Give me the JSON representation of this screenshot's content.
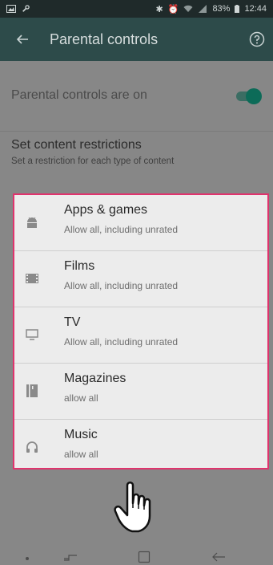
{
  "status_bar": {
    "battery": "83%",
    "time": "12:44"
  },
  "app_bar": {
    "title": "Parental controls"
  },
  "settings": {
    "toggle_label": "Parental controls are on",
    "restrictions_title": "Set content restrictions",
    "restrictions_subtitle": "Set a restriction for each type of content"
  },
  "categories": [
    {
      "icon": "android-icon",
      "title": "Apps & games",
      "subtitle": "Allow all, including unrated"
    },
    {
      "icon": "film-icon",
      "title": "Films",
      "subtitle": "Allow all, including unrated"
    },
    {
      "icon": "tv-icon",
      "title": "TV",
      "subtitle": "Allow all, including unrated"
    },
    {
      "icon": "magazine-icon",
      "title": "Magazines",
      "subtitle": "allow all"
    },
    {
      "icon": "headphones-icon",
      "title": "Music",
      "subtitle": "allow all"
    }
  ],
  "colors": {
    "highlight_border": "#e0336d",
    "toggle_on": "#0c6b58",
    "app_bar": "#2d4b4a"
  }
}
